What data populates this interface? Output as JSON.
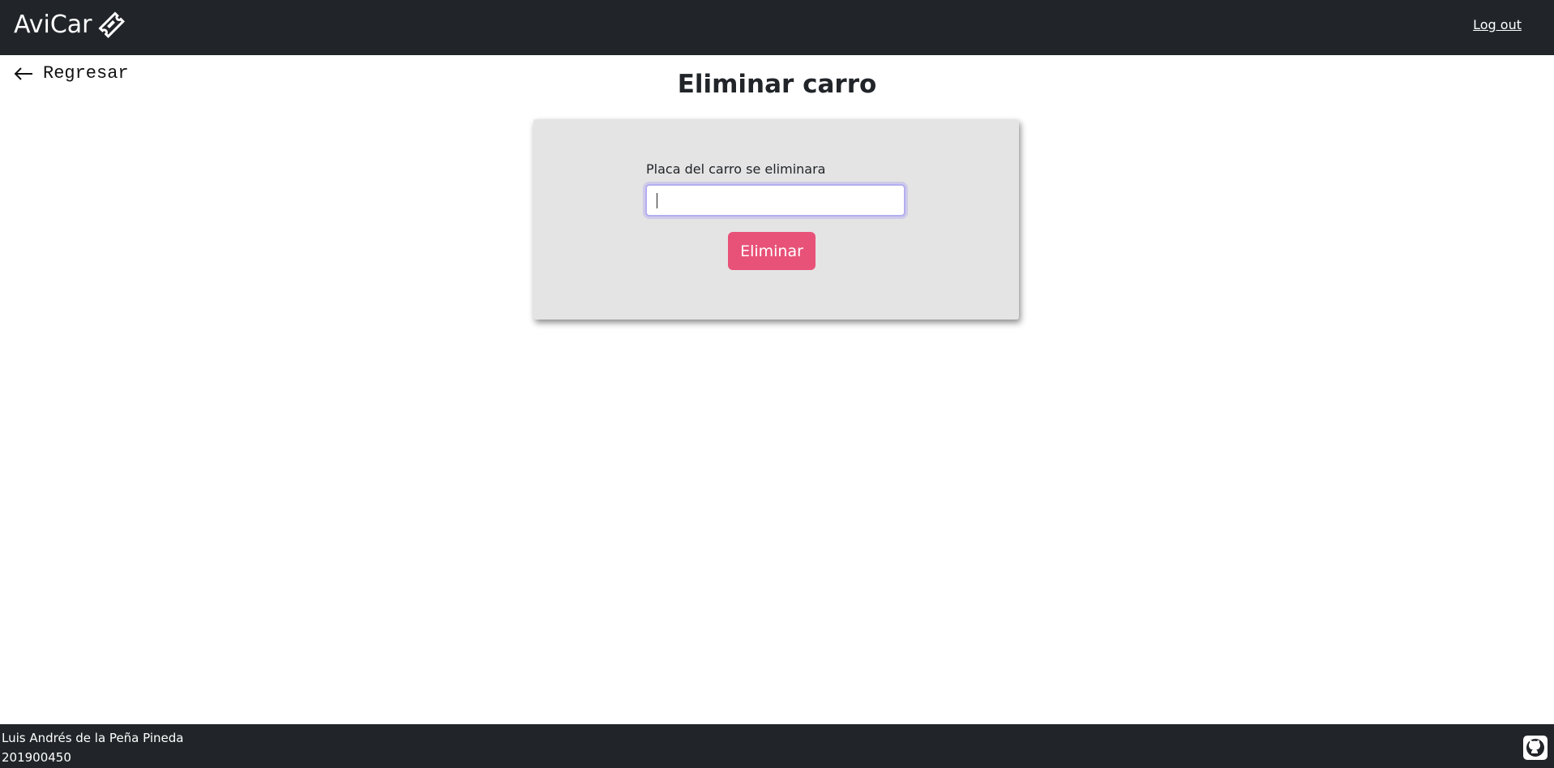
{
  "navbar": {
    "brand": "AviCar",
    "brand_icon": "ticket-icon",
    "logout_label": "Log out"
  },
  "back": {
    "label": "Regresar",
    "icon": "arrow-left-icon"
  },
  "page_title": "Eliminar carro",
  "form": {
    "label": "Placa del carro se eliminara",
    "input_value": "",
    "submit_label": "Eliminar"
  },
  "footer": {
    "author": "Luis Andrés de la Peña Pineda",
    "student_id": "201900450",
    "icon": "github-icon"
  },
  "colors": {
    "navbar_bg": "#212529",
    "card_bg": "#e4e4e4",
    "button_bg": "#e85278"
  }
}
